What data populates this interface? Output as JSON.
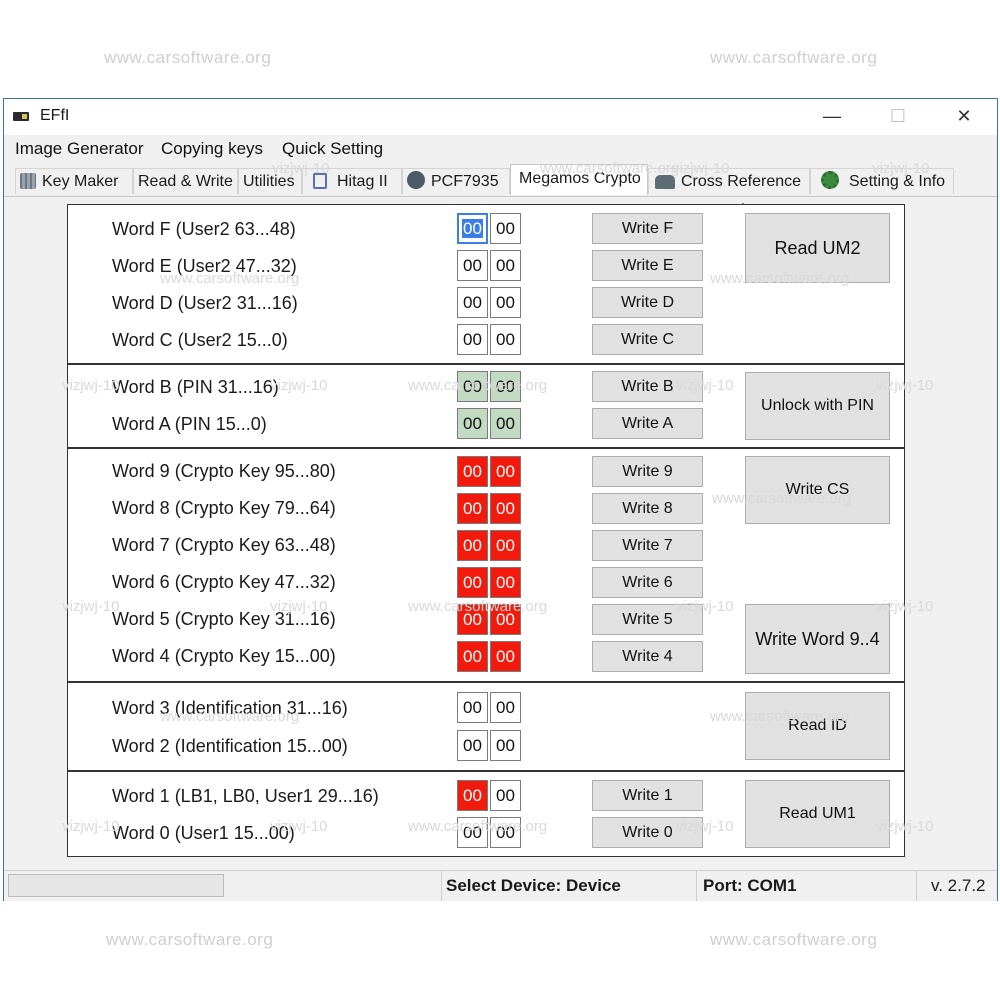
{
  "watermarks": {
    "site": "www.carsoftware.org",
    "tag": "vizjwj-10",
    "tag_alt": "vizjwj-10"
  },
  "window": {
    "title": "EFfI",
    "minimize": "—",
    "maximize": "☐",
    "close": "✕"
  },
  "menu": [
    "Image Generator",
    "Copying keys",
    "Quick Setting"
  ],
  "tabs": [
    {
      "label": "Key Maker",
      "icon": "calculator-icon"
    },
    {
      "label": "Read & Write",
      "icon": ""
    },
    {
      "label": "Utilities",
      "icon": ""
    },
    {
      "label": "Hitag II",
      "icon": "chip-icon"
    },
    {
      "label": "PCF7935",
      "icon": "pcf-icon"
    },
    {
      "label": "Megamos Crypto",
      "icon": "",
      "active": true
    },
    {
      "label": "Cross Reference",
      "icon": "car-icon"
    },
    {
      "label": "Setting & Info",
      "icon": "gear-icon"
    }
  ],
  "words": [
    {
      "label": "Word F (User2 63...48)",
      "bytes": [
        "00",
        "00"
      ],
      "style": "white",
      "button": "Write F"
    },
    {
      "label": "Word E (User2 47...32)",
      "bytes": [
        "00",
        "00"
      ],
      "style": "white",
      "button": "Write E"
    },
    {
      "label": "Word D (User2 31...16)",
      "bytes": [
        "00",
        "00"
      ],
      "style": "white",
      "button": "Write D"
    },
    {
      "label": "Word C (User2 15...0)",
      "bytes": [
        "00",
        "00"
      ],
      "style": "white",
      "button": "Write C"
    },
    {
      "label": "Word B (PIN 31...16)",
      "bytes": [
        "00",
        "00"
      ],
      "style": "green",
      "button": "Write B"
    },
    {
      "label": "Word A (PIN 15...0)",
      "bytes": [
        "00",
        "00"
      ],
      "style": "green",
      "button": "Write A"
    },
    {
      "label": "Word 9 (Crypto Key 95...80)",
      "bytes": [
        "00",
        "00"
      ],
      "style": "red",
      "button": "Write 9"
    },
    {
      "label": "Word 8 (Crypto Key 79...64)",
      "bytes": [
        "00",
        "00"
      ],
      "style": "red",
      "button": "Write 8"
    },
    {
      "label": "Word 7 (Crypto Key 63...48)",
      "bytes": [
        "00",
        "00"
      ],
      "style": "red",
      "button": "Write 7"
    },
    {
      "label": "Word 6 (Crypto Key 47...32)",
      "bytes": [
        "00",
        "00"
      ],
      "style": "red",
      "button": "Write 6"
    },
    {
      "label": "Word 5 (Crypto Key 31...16)",
      "bytes": [
        "00",
        "00"
      ],
      "style": "red",
      "button": "Write 5"
    },
    {
      "label": "Word 4 (Crypto Key 15...00)",
      "bytes": [
        "00",
        "00"
      ],
      "style": "red",
      "button": "Write 4"
    },
    {
      "label": "Word 3 (Identification 31...16)",
      "bytes": [
        "00",
        "00"
      ],
      "style": "white",
      "button": ""
    },
    {
      "label": "Word 2 (Identification 15...00)",
      "bytes": [
        "00",
        "00"
      ],
      "style": "white",
      "button": ""
    },
    {
      "label": "Word 1 (LB1, LB0, User1 29...16)",
      "bytes": [
        "00",
        "00"
      ],
      "style": "first-red",
      "button": "Write 1"
    },
    {
      "label": "Word 0 (User1 15...00)",
      "bytes": [
        "00",
        "00"
      ],
      "style": "white",
      "button": "Write 0"
    }
  ],
  "actions": {
    "read_um2": "Read UM2",
    "unlock_pin": "Unlock with PIN",
    "write_cs": "Write CS",
    "write_word_9_4": "Write Word 9..4",
    "read_id": "Read ID",
    "read_um1": "Read UM1"
  },
  "status": {
    "device_label": "Select Device:",
    "device_value": "Device",
    "port_label": "Port:",
    "port_value": "COM1",
    "version": "v. 2.7.2"
  },
  "colors": {
    "red_cell": "#f11a0c",
    "green_cell": "#c2d9c2",
    "selection": "#3c7ee8",
    "window_border": "#3f6fb6"
  }
}
